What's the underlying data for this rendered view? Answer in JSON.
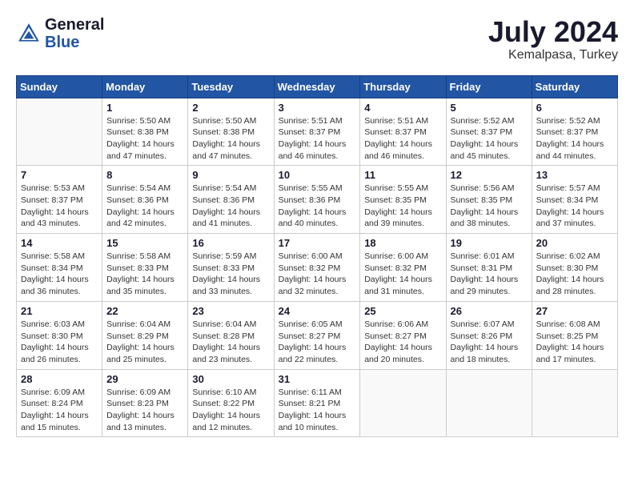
{
  "header": {
    "logo_general": "General",
    "logo_blue": "Blue",
    "month_year": "July 2024",
    "location": "Kemalpasa, Turkey"
  },
  "columns": [
    "Sunday",
    "Monday",
    "Tuesday",
    "Wednesday",
    "Thursday",
    "Friday",
    "Saturday"
  ],
  "weeks": [
    [
      {
        "day": "",
        "info": ""
      },
      {
        "day": "1",
        "info": "Sunrise: 5:50 AM\nSunset: 8:38 PM\nDaylight: 14 hours\nand 47 minutes."
      },
      {
        "day": "2",
        "info": "Sunrise: 5:50 AM\nSunset: 8:38 PM\nDaylight: 14 hours\nand 47 minutes."
      },
      {
        "day": "3",
        "info": "Sunrise: 5:51 AM\nSunset: 8:37 PM\nDaylight: 14 hours\nand 46 minutes."
      },
      {
        "day": "4",
        "info": "Sunrise: 5:51 AM\nSunset: 8:37 PM\nDaylight: 14 hours\nand 46 minutes."
      },
      {
        "day": "5",
        "info": "Sunrise: 5:52 AM\nSunset: 8:37 PM\nDaylight: 14 hours\nand 45 minutes."
      },
      {
        "day": "6",
        "info": "Sunrise: 5:52 AM\nSunset: 8:37 PM\nDaylight: 14 hours\nand 44 minutes."
      }
    ],
    [
      {
        "day": "7",
        "info": "Sunrise: 5:53 AM\nSunset: 8:37 PM\nDaylight: 14 hours\nand 43 minutes."
      },
      {
        "day": "8",
        "info": "Sunrise: 5:54 AM\nSunset: 8:36 PM\nDaylight: 14 hours\nand 42 minutes."
      },
      {
        "day": "9",
        "info": "Sunrise: 5:54 AM\nSunset: 8:36 PM\nDaylight: 14 hours\nand 41 minutes."
      },
      {
        "day": "10",
        "info": "Sunrise: 5:55 AM\nSunset: 8:36 PM\nDaylight: 14 hours\nand 40 minutes."
      },
      {
        "day": "11",
        "info": "Sunrise: 5:55 AM\nSunset: 8:35 PM\nDaylight: 14 hours\nand 39 minutes."
      },
      {
        "day": "12",
        "info": "Sunrise: 5:56 AM\nSunset: 8:35 PM\nDaylight: 14 hours\nand 38 minutes."
      },
      {
        "day": "13",
        "info": "Sunrise: 5:57 AM\nSunset: 8:34 PM\nDaylight: 14 hours\nand 37 minutes."
      }
    ],
    [
      {
        "day": "14",
        "info": "Sunrise: 5:58 AM\nSunset: 8:34 PM\nDaylight: 14 hours\nand 36 minutes."
      },
      {
        "day": "15",
        "info": "Sunrise: 5:58 AM\nSunset: 8:33 PM\nDaylight: 14 hours\nand 35 minutes."
      },
      {
        "day": "16",
        "info": "Sunrise: 5:59 AM\nSunset: 8:33 PM\nDaylight: 14 hours\nand 33 minutes."
      },
      {
        "day": "17",
        "info": "Sunrise: 6:00 AM\nSunset: 8:32 PM\nDaylight: 14 hours\nand 32 minutes."
      },
      {
        "day": "18",
        "info": "Sunrise: 6:00 AM\nSunset: 8:32 PM\nDaylight: 14 hours\nand 31 minutes."
      },
      {
        "day": "19",
        "info": "Sunrise: 6:01 AM\nSunset: 8:31 PM\nDaylight: 14 hours\nand 29 minutes."
      },
      {
        "day": "20",
        "info": "Sunrise: 6:02 AM\nSunset: 8:30 PM\nDaylight: 14 hours\nand 28 minutes."
      }
    ],
    [
      {
        "day": "21",
        "info": "Sunrise: 6:03 AM\nSunset: 8:30 PM\nDaylight: 14 hours\nand 26 minutes."
      },
      {
        "day": "22",
        "info": "Sunrise: 6:04 AM\nSunset: 8:29 PM\nDaylight: 14 hours\nand 25 minutes."
      },
      {
        "day": "23",
        "info": "Sunrise: 6:04 AM\nSunset: 8:28 PM\nDaylight: 14 hours\nand 23 minutes."
      },
      {
        "day": "24",
        "info": "Sunrise: 6:05 AM\nSunset: 8:27 PM\nDaylight: 14 hours\nand 22 minutes."
      },
      {
        "day": "25",
        "info": "Sunrise: 6:06 AM\nSunset: 8:27 PM\nDaylight: 14 hours\nand 20 minutes."
      },
      {
        "day": "26",
        "info": "Sunrise: 6:07 AM\nSunset: 8:26 PM\nDaylight: 14 hours\nand 18 minutes."
      },
      {
        "day": "27",
        "info": "Sunrise: 6:08 AM\nSunset: 8:25 PM\nDaylight: 14 hours\nand 17 minutes."
      }
    ],
    [
      {
        "day": "28",
        "info": "Sunrise: 6:09 AM\nSunset: 8:24 PM\nDaylight: 14 hours\nand 15 minutes."
      },
      {
        "day": "29",
        "info": "Sunrise: 6:09 AM\nSunset: 8:23 PM\nDaylight: 14 hours\nand 13 minutes."
      },
      {
        "day": "30",
        "info": "Sunrise: 6:10 AM\nSunset: 8:22 PM\nDaylight: 14 hours\nand 12 minutes."
      },
      {
        "day": "31",
        "info": "Sunrise: 6:11 AM\nSunset: 8:21 PM\nDaylight: 14 hours\nand 10 minutes."
      },
      {
        "day": "",
        "info": ""
      },
      {
        "day": "",
        "info": ""
      },
      {
        "day": "",
        "info": ""
      }
    ]
  ]
}
